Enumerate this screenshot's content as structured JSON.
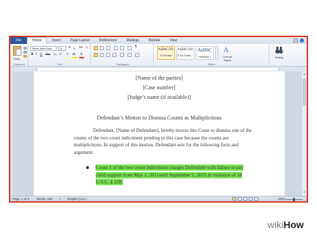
{
  "tabs": [
    "File",
    "Home",
    "Insert",
    "Page Layout",
    "References",
    "Mailings",
    "Review",
    "View"
  ],
  "active_tab": "Home",
  "window_controls": [
    "–",
    "□",
    "×"
  ],
  "ribbon": {
    "clipboard": {
      "paste_label": "Paste",
      "group_label": "Clipboard"
    },
    "font": {
      "font_name": "Times New Rom",
      "font_size": "14",
      "group_label": "Font"
    },
    "paragraph": {
      "group_label": "Paragraph"
    },
    "styles": {
      "items": [
        {
          "sample": "AaBbCcDc",
          "name": "¶ Normal"
        },
        {
          "sample": "AaBbCcDc",
          "name": "¶ No Spaci..."
        },
        {
          "sample": "AaBbC",
          "name": "Heading 1"
        }
      ],
      "change_styles": "Change Styles",
      "group_label": "Styles"
    },
    "editing": {
      "label": "Editing"
    }
  },
  "document": {
    "lines": [
      "[Name of the parties]",
      "[Case number]",
      "[Judge’s name (if available)]"
    ],
    "title": "Defendant’s Motion to Dismiss Counts as Multiplicitous",
    "paragraph": "Defendant, [Name of Defendant], hereby moves this Court to dismiss one of the counts of the two count indictment pending in this case because the counts are multiplicitous. In support of this motion, Defendant sets for the following facts and argument:",
    "bullet": "Count 1 of the two count indictment charges Defendant with failure to pay child support from May 1, 2011until September 2, 2015 in violation of 18 U.S.C. § 228."
  },
  "status": {
    "page": "Page: 1 of 2",
    "words": "Words: 166",
    "language": "English (U.S.)",
    "zoom": "100%"
  },
  "watermark": {
    "part1": "wiki",
    "part2": "How"
  },
  "colors": {
    "highlight": "#72e04a",
    "frame": "#e0341c",
    "file_tab": "#2b5797"
  }
}
